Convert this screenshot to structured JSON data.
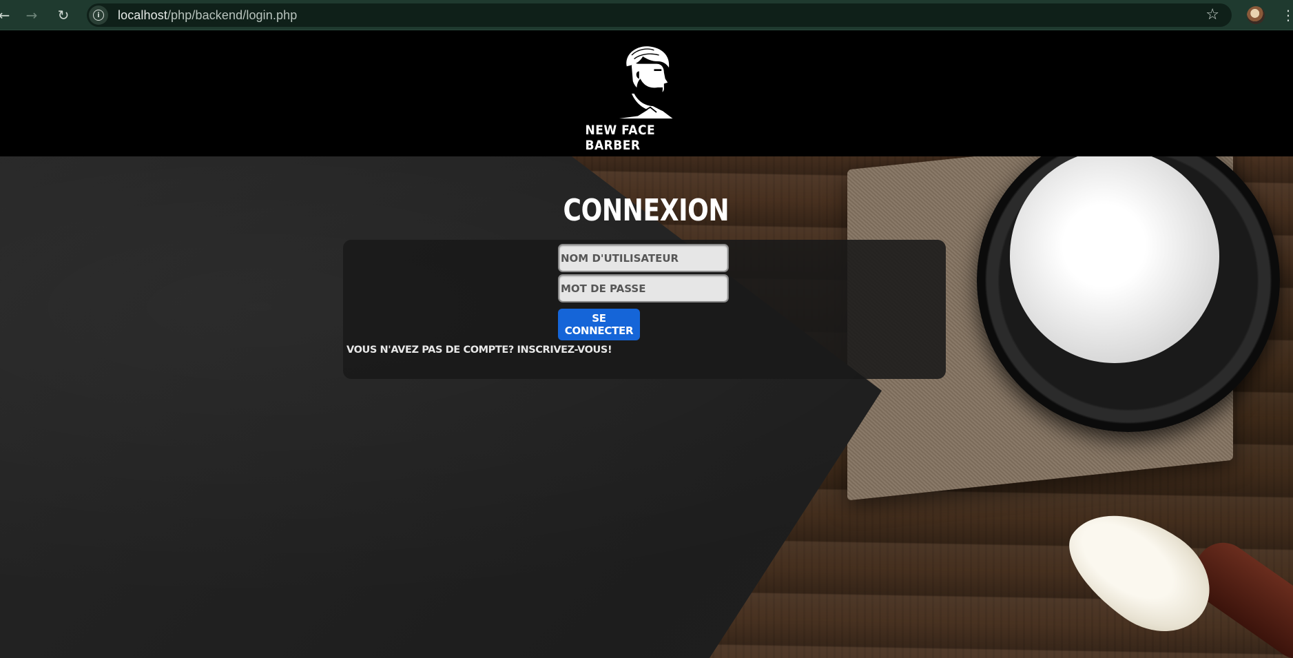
{
  "browser": {
    "url_host": "localhost",
    "url_path": "/php/backend/login.php",
    "back_icon": "arrow-left-icon",
    "forward_icon": "arrow-right-icon",
    "reload_icon": "reload-icon",
    "site_info_icon": "info-icon",
    "bookmark_icon": "star-icon",
    "menu_icon": "kebab-icon"
  },
  "header": {
    "logo_text": "NEW FACE BARBER"
  },
  "login": {
    "title": "CONNEXION",
    "username_placeholder": "NOM D'UTILISATEUR",
    "password_placeholder": "MOT DE PASSE",
    "submit_label": "SE CONNECTER",
    "signup_text": "VOUS N'AVEZ PAS DE COMPTE? INSCRIVEZ-VOUS!"
  },
  "colors": {
    "browser_bar": "#1f3a2f",
    "button": "#1565d8",
    "header_bg": "#000000"
  }
}
